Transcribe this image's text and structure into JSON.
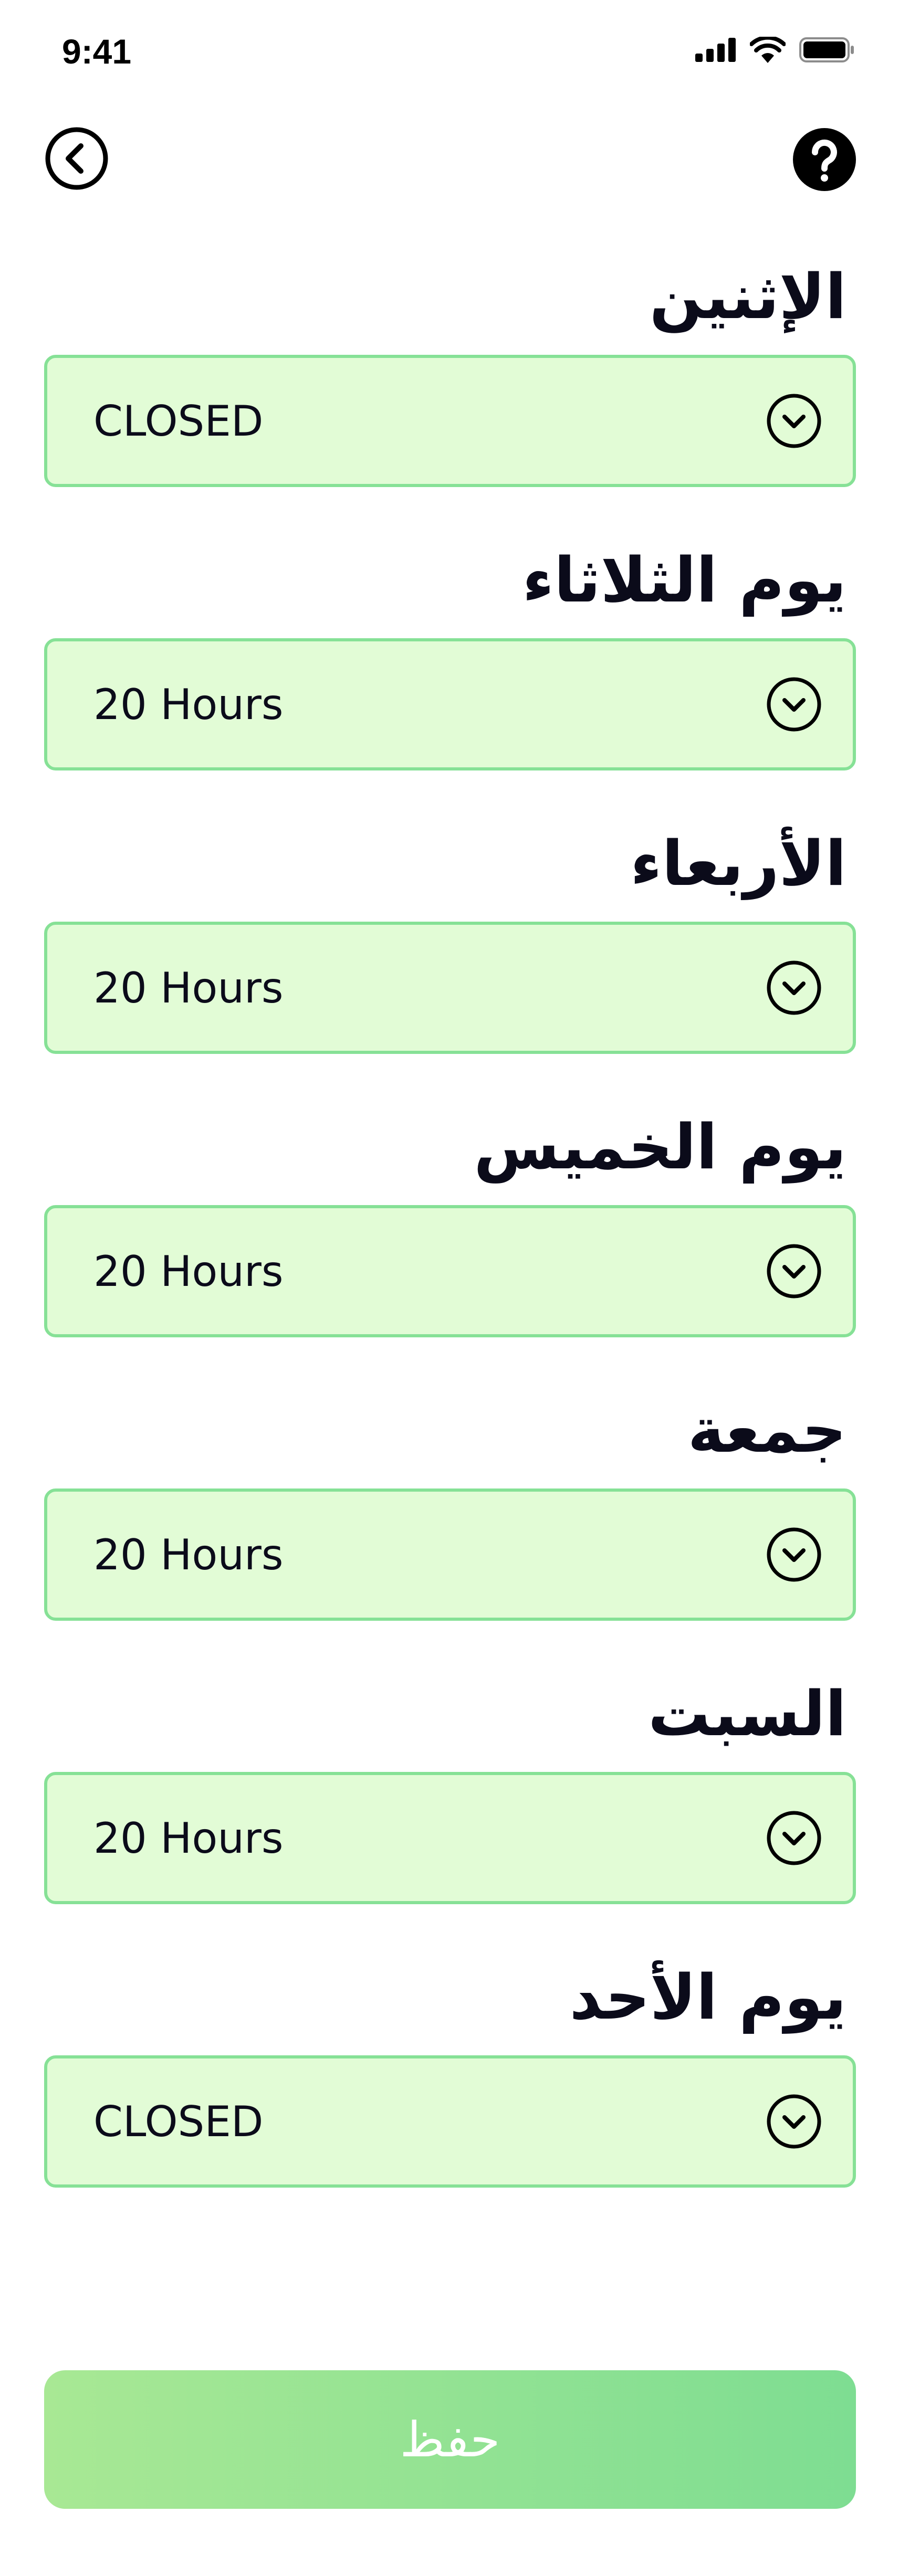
{
  "status_bar": {
    "time": "9:41",
    "icons": [
      "cellular-signal-icon",
      "wifi-icon",
      "battery-icon"
    ]
  },
  "header": {
    "back_icon": "chevron-left-circle-icon",
    "help_icon": "question-circle-icon"
  },
  "days": [
    {
      "label": "الإثنين",
      "value": "CLOSED"
    },
    {
      "label": "يوم الثلاثاء",
      "value": "20 Hours"
    },
    {
      "label": "الأربعاء",
      "value": "20 Hours"
    },
    {
      "label": "يوم الخميس",
      "value": "20 Hours"
    },
    {
      "label": "جمعة",
      "value": "20 Hours"
    },
    {
      "label": "السبت",
      "value": "20 Hours"
    },
    {
      "label": "يوم الأحد",
      "value": "CLOSED"
    }
  ],
  "dropdown_icon": "chevron-down-circle-icon",
  "save": {
    "label": "حفظ"
  },
  "colors": {
    "field_background": "#e2fcd6",
    "field_border": "#86e196",
    "save_gradient_start": "#a8e894",
    "save_gradient_end": "#7edd92",
    "text": "#0b0b1a"
  }
}
